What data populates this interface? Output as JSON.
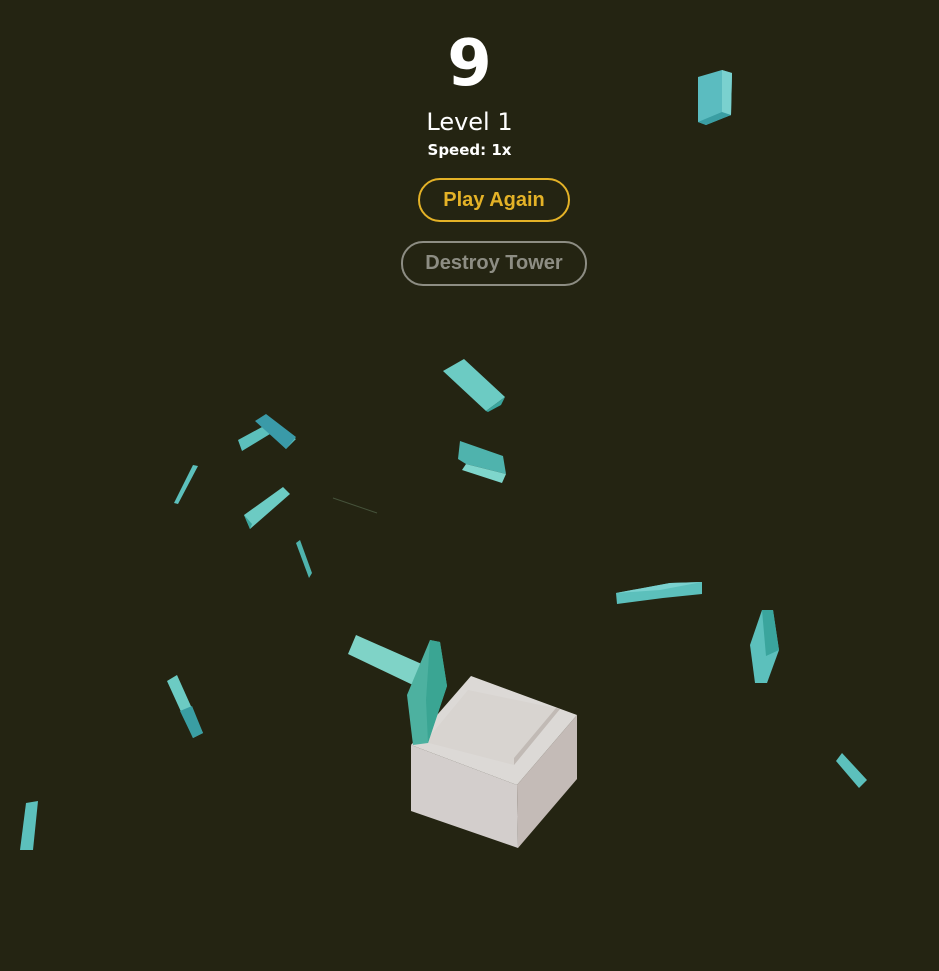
{
  "hud": {
    "score": "9",
    "level": "Level 1",
    "speed": "Speed: 1x"
  },
  "buttons": {
    "play_again": "Play Again",
    "destroy_tower": "Destroy Tower"
  },
  "colors": {
    "background": "#242412",
    "accent": "#e4b227",
    "secondary_button": "#8d8d83",
    "block_teal": "#6ec9c2",
    "base_block": "#d7d1cd"
  }
}
